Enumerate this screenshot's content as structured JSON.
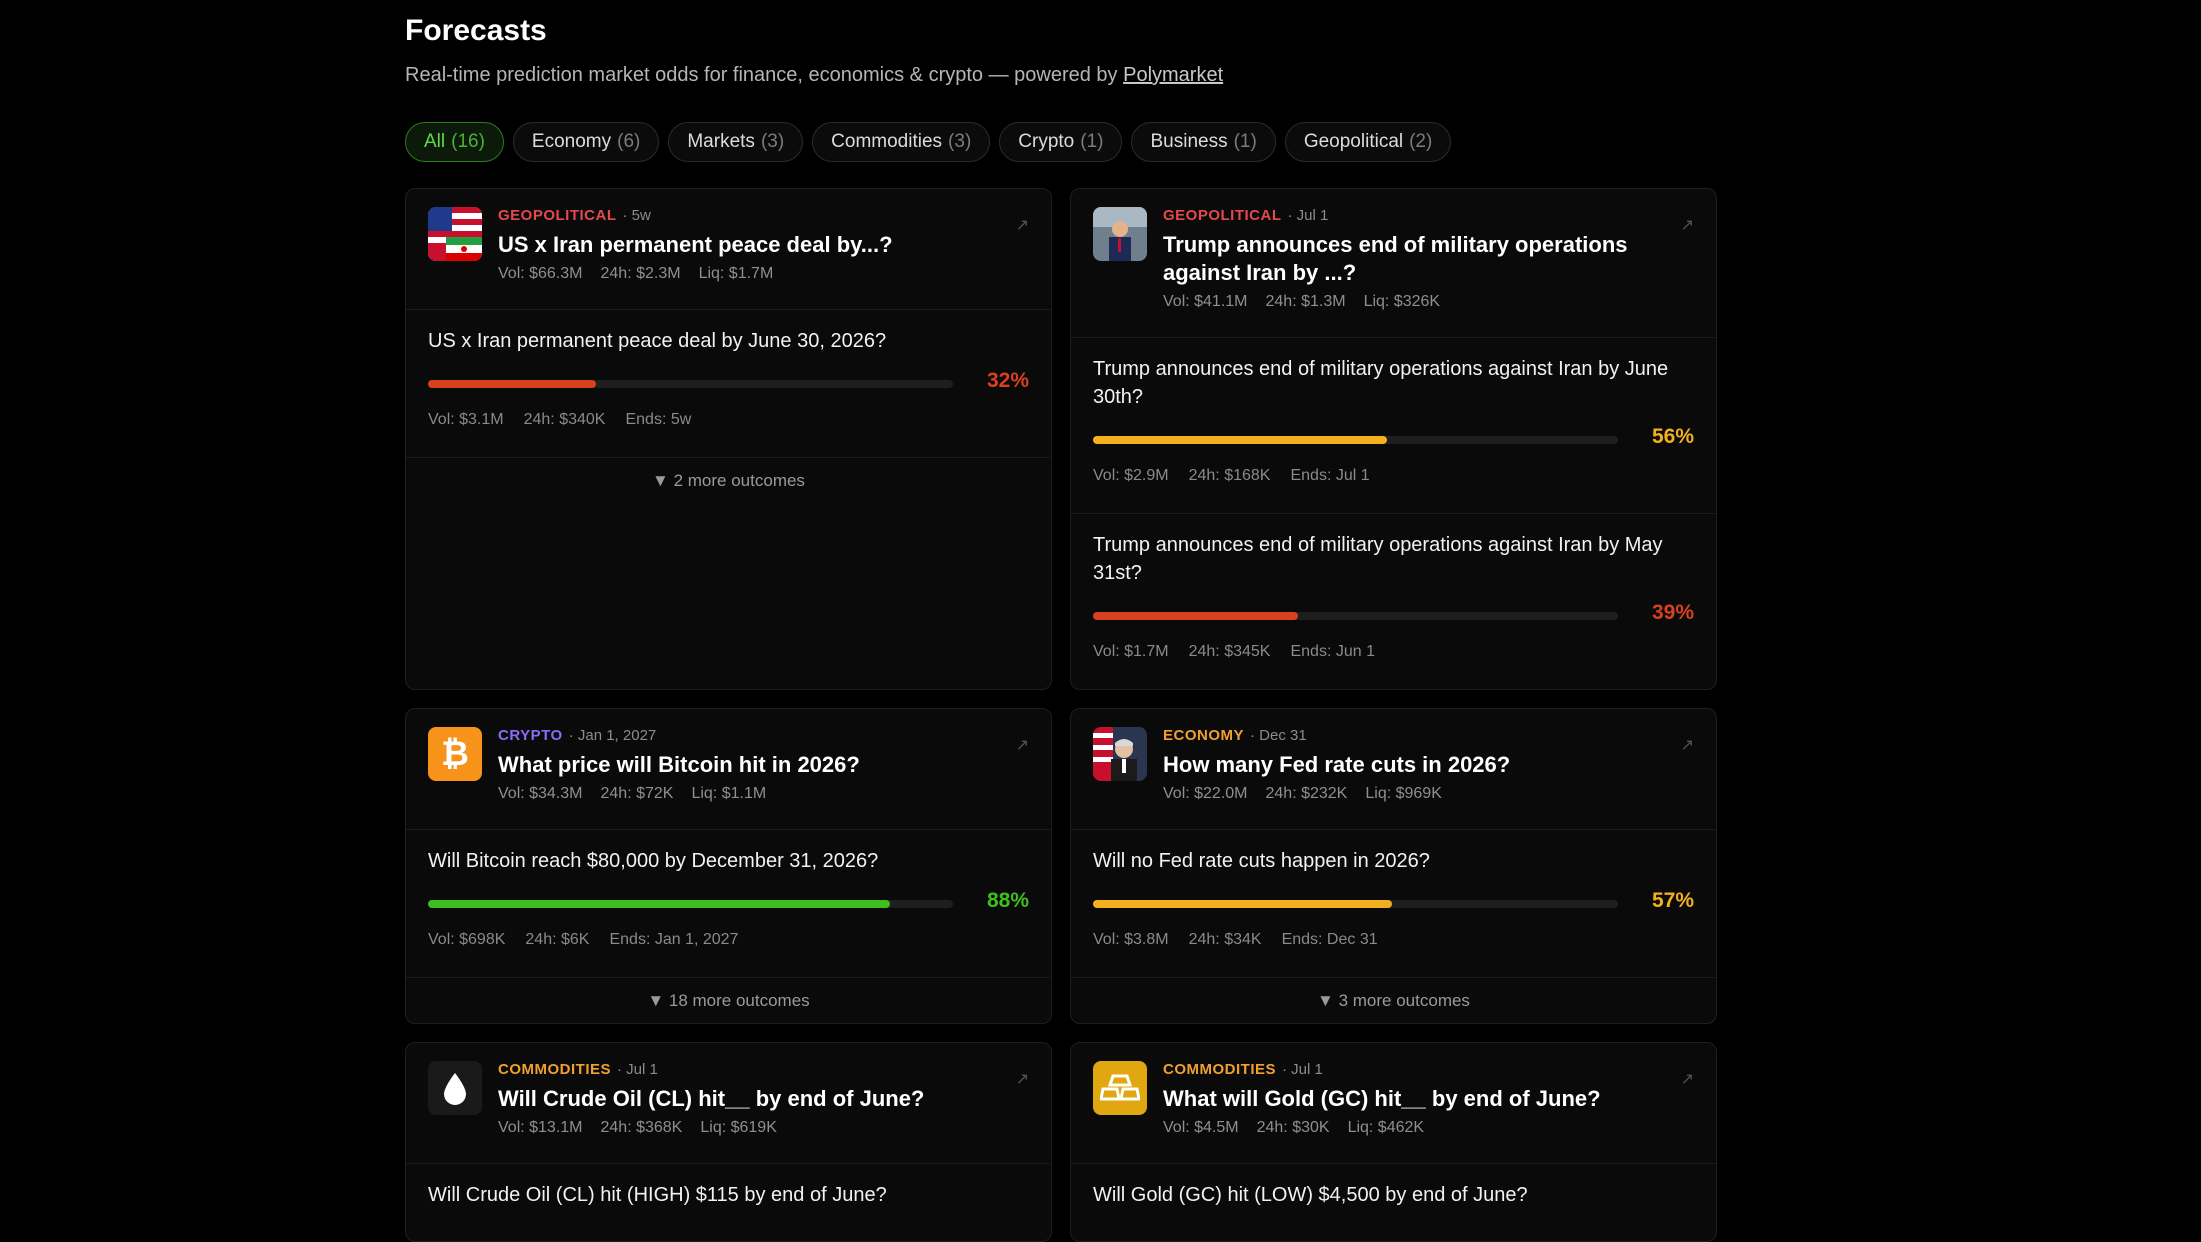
{
  "header": {
    "title": "Forecasts",
    "subtitle": "Real-time prediction market odds for finance, economics & crypto — powered by",
    "link": "Polymarket"
  },
  "filters": [
    {
      "label": "All",
      "count": "(16)"
    },
    {
      "label": "Economy",
      "count": "(6)"
    },
    {
      "label": "Markets",
      "count": "(3)"
    },
    {
      "label": "Commodities",
      "count": "(3)"
    },
    {
      "label": "Crypto",
      "count": "(1)"
    },
    {
      "label": "Business",
      "count": "(1)"
    },
    {
      "label": "Geopolitical",
      "count": "(2)"
    }
  ],
  "colors": {
    "geopolitical": "#e5484d",
    "crypto": "#8b6cf6",
    "economy": "#f0a030",
    "commodities": "#f0a030",
    "red": "#d9411e",
    "yellow": "#f2b01e",
    "green": "#3cbf1f"
  },
  "cards": [
    {
      "category": "GEOPOLITICAL",
      "date": "· 5w",
      "title": "US x Iran permanent peace deal by...?",
      "vol": "Vol: $66.3M",
      "h24": "24h: $2.3M",
      "liq": "Liq: $1.7M",
      "outcomes": [
        {
          "question": "US x Iran permanent peace deal by June 30, 2026?",
          "pct": "32%",
          "value": 0.32,
          "vol": "Vol: $3.1M",
          "h24": "24h: $340K",
          "ends": "Ends: 5w"
        }
      ],
      "more": "▼ 2 more outcomes"
    },
    {
      "category": "GEOPOLITICAL",
      "date": "· Jul 1",
      "title": "Trump announces end of military operations against Iran by ...?",
      "vol": "Vol: $41.1M",
      "h24": "24h: $1.3M",
      "liq": "Liq: $326K",
      "outcomes": [
        {
          "question": "Trump announces end of military operations against Iran by June 30th?",
          "pct": "56%",
          "value": 0.56,
          "vol": "Vol: $2.9M",
          "h24": "24h: $168K",
          "ends": "Ends: Jul 1"
        },
        {
          "question": "Trump announces end of military operations against Iran by May 31st?",
          "pct": "39%",
          "value": 0.39,
          "vol": "Vol: $1.7M",
          "h24": "24h: $345K",
          "ends": "Ends: Jun 1"
        }
      ]
    },
    {
      "category": "CRYPTO",
      "date": "· Jan 1, 2027",
      "title": "What price will Bitcoin hit in 2026?",
      "vol": "Vol: $34.3M",
      "h24": "24h: $72K",
      "liq": "Liq: $1.1M",
      "outcomes": [
        {
          "question": "Will Bitcoin reach $80,000 by December 31, 2026?",
          "pct": "88%",
          "value": 0.88,
          "vol": "Vol: $698K",
          "h24": "24h: $6K",
          "ends": "Ends: Jan 1, 2027"
        }
      ],
      "more": "▼ 18 more outcomes"
    },
    {
      "category": "ECONOMY",
      "date": "· Dec 31",
      "title": "How many Fed rate cuts in 2026?",
      "vol": "Vol: $22.0M",
      "h24": "24h: $232K",
      "liq": "Liq: $969K",
      "outcomes": [
        {
          "question": "Will no Fed rate cuts happen in 2026?",
          "pct": "57%",
          "value": 0.57,
          "vol": "Vol: $3.8M",
          "h24": "24h: $34K",
          "ends": "Ends: Dec 31"
        }
      ],
      "more": "▼ 3 more outcomes"
    },
    {
      "category": "COMMODITIES",
      "date": "· Jul 1",
      "title": "Will Crude Oil (CL) hit__ by end of June?",
      "vol": "Vol: $13.1M",
      "h24": "24h: $368K",
      "liq": "Liq: $619K",
      "outcomes": [
        {
          "question": "Will Crude Oil (CL) hit (HIGH) $115 by end of June?"
        }
      ]
    },
    {
      "category": "COMMODITIES",
      "date": "· Jul 1",
      "title": "What will Gold (GC) hit__ by end of June?",
      "vol": "Vol: $4.5M",
      "h24": "24h: $30K",
      "liq": "Liq: $462K",
      "outcomes": [
        {
          "question": "Will Gold (GC) hit (LOW) $4,500 by end of June?"
        }
      ]
    }
  ],
  "icons": {
    "external": "external-link-icon"
  }
}
